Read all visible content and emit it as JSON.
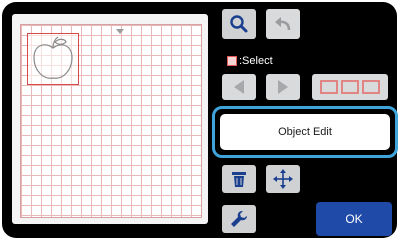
{
  "select_label": ":Select",
  "object_edit_label": "Object Edit",
  "ok_label": "OK",
  "icons": {
    "zoom": "magnifier-icon",
    "undo": "undo-arrow-icon",
    "prev": "left-arrow-icon",
    "next": "right-arrow-icon",
    "multi_select": "multi-select-icon",
    "delete": "trash-icon",
    "move": "move-arrows-icon",
    "settings": "wrench-icon"
  },
  "colors": {
    "accent_highlight": "#3fa4dc",
    "ok_button": "#1f4aa8",
    "selection": "#d84a4a",
    "grid": "#e9b8b8"
  }
}
